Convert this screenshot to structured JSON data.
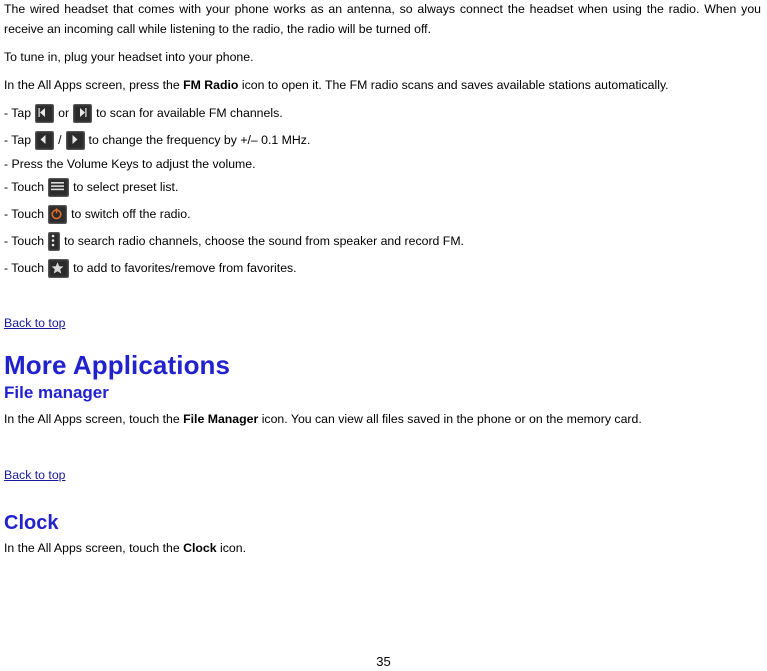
{
  "document": {
    "paragraphs": {
      "intro": "The wired headset that comes with your phone works as an antenna, so always connect the headset when using the radio. When you receive an incoming call while listening to the radio, the radio will be turned off.",
      "tune": "To tune in, plug your headset into your phone.",
      "allapps_pre": "In the All Apps screen, press the ",
      "allapps_bold": "FM Radio",
      "allapps_post": " icon to open it. The FM radio scans and saves available stations automatically."
    },
    "bullets": [
      {
        "prefix": "- Tap",
        "mid": "or",
        "suffix": "to scan for available FM channels.",
        "icons": [
          "scan-left-icon",
          "scan-right-icon"
        ]
      },
      {
        "prefix": "- Tap",
        "mid": "/",
        "suffix": "to change the frequency by +/– 0.1 MHz.",
        "icons": [
          "tune-left-icon",
          "tune-right-icon"
        ]
      },
      {
        "prefix": "- Press the Volume Keys to adjust the volume.",
        "mid": "",
        "suffix": "",
        "icons": []
      },
      {
        "prefix": "- Touch",
        "mid": "",
        "suffix": "to select preset list.",
        "icons": [
          "preset-list-icon"
        ]
      },
      {
        "prefix": "- Touch",
        "mid": "",
        "suffix": "to switch off the radio.",
        "icons": [
          "power-off-icon"
        ]
      },
      {
        "prefix": "- Touch",
        "mid": "",
        "suffix": "to search radio channels, choose the sound from speaker and record FM.",
        "icons": [
          "more-options-icon"
        ]
      },
      {
        "prefix": "- Touch",
        "mid": "",
        "suffix": "to add to favorites/remove from favorites.",
        "icons": [
          "favorite-star-icon"
        ]
      }
    ],
    "links": {
      "back_to_top_1": "Back to top",
      "back_to_top_2": "Back to top"
    },
    "headings": {
      "more_applications": "More Applications",
      "file_manager": "File manager",
      "clock": "Clock"
    },
    "file_manager_text": {
      "pre": "In the All Apps screen, touch the ",
      "bold": "File Manager",
      "post": " icon. You can view all files saved in the phone or on the memory card."
    },
    "clock_text": {
      "pre": "In the All Apps screen, touch the ",
      "bold": "Clock",
      "post": " icon."
    },
    "page_number": "35"
  }
}
